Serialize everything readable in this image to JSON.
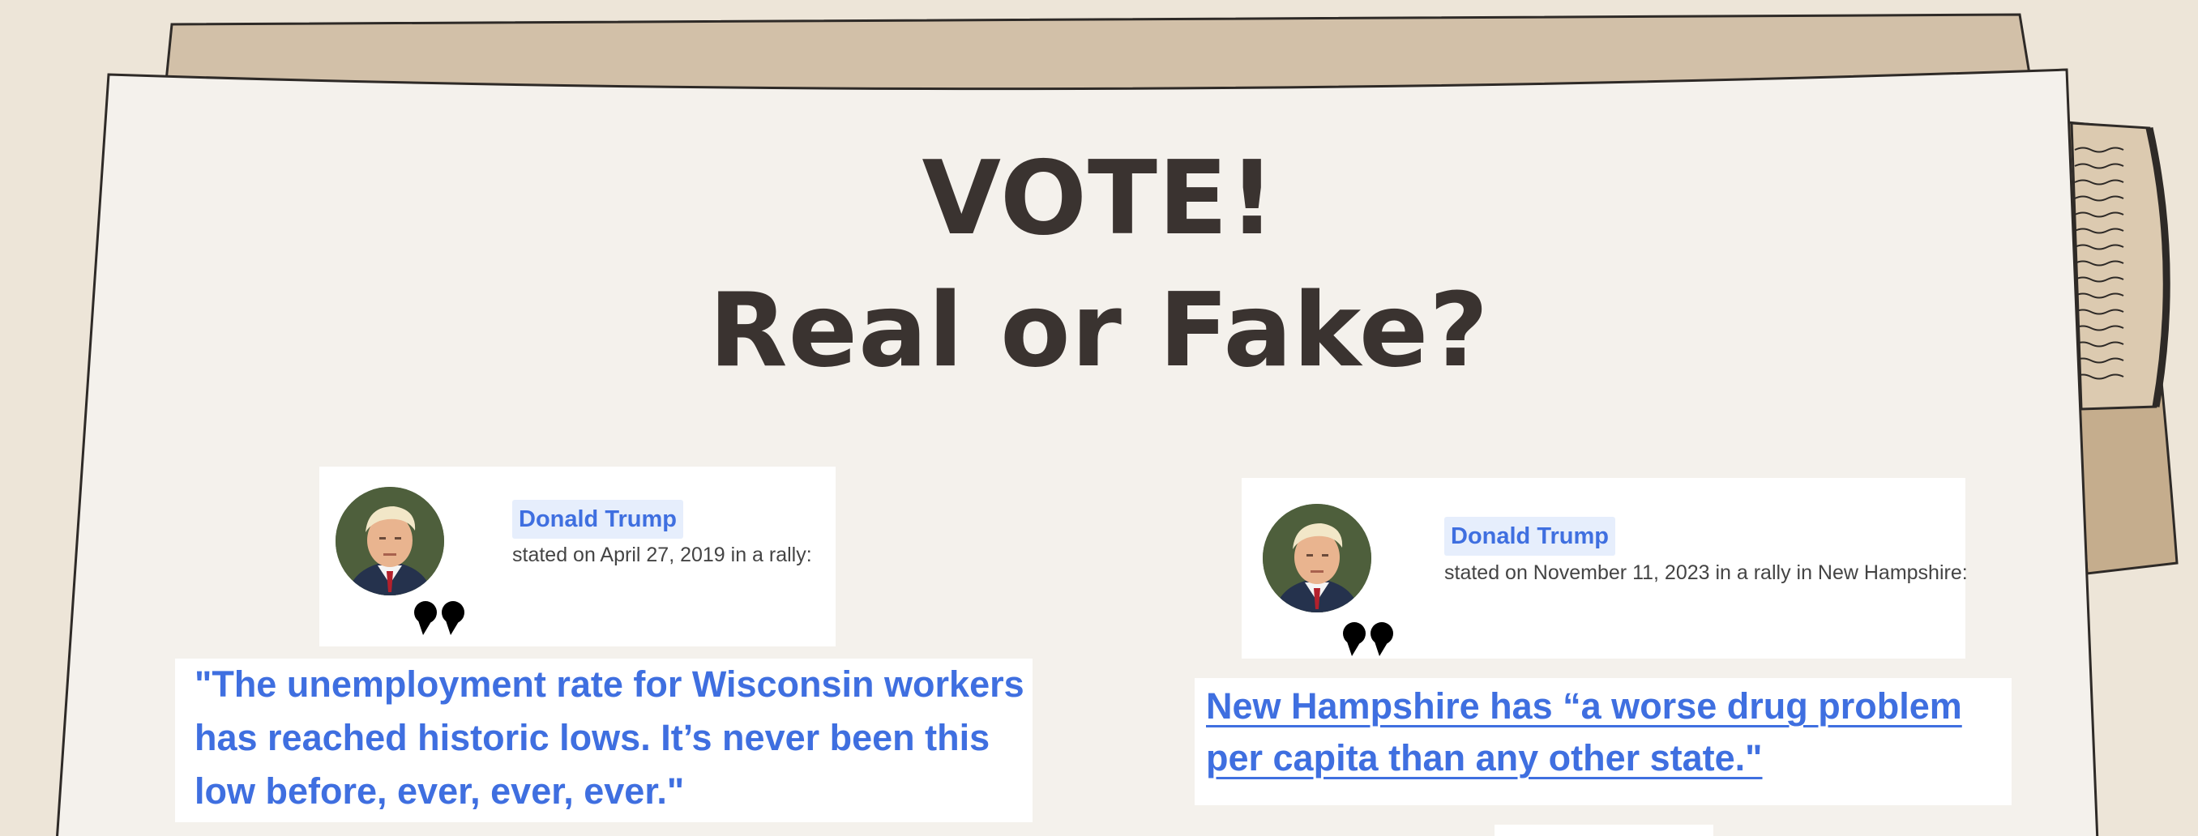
{
  "header": {
    "line1": "VOTE!",
    "line2": "Real or Fake?"
  },
  "cards": [
    {
      "speaker": "Donald Trump",
      "meta": "stated on April 27, 2019 in a rally:",
      "quote": "\"The unemployment rate for Wisconsin workers has reached historic lows. It’s never been this low before, ever, ever, ever.\""
    },
    {
      "speaker": "Donald Trump",
      "meta": "stated on November 11, 2023 in a rally in New Hampshire:",
      "quote": "New Hampshire has “a worse drug problem per capita than any other state.\""
    }
  ],
  "colors": {
    "background": "#ede5d8",
    "paper": "#f4f1ec",
    "paper_back": "#d2c0a8",
    "title_text": "#3a3330",
    "link_blue": "#3f6fe0",
    "name_tag_bg": "#e6eefc"
  },
  "icons": {
    "quote_mark": "closing-quote-icon"
  }
}
